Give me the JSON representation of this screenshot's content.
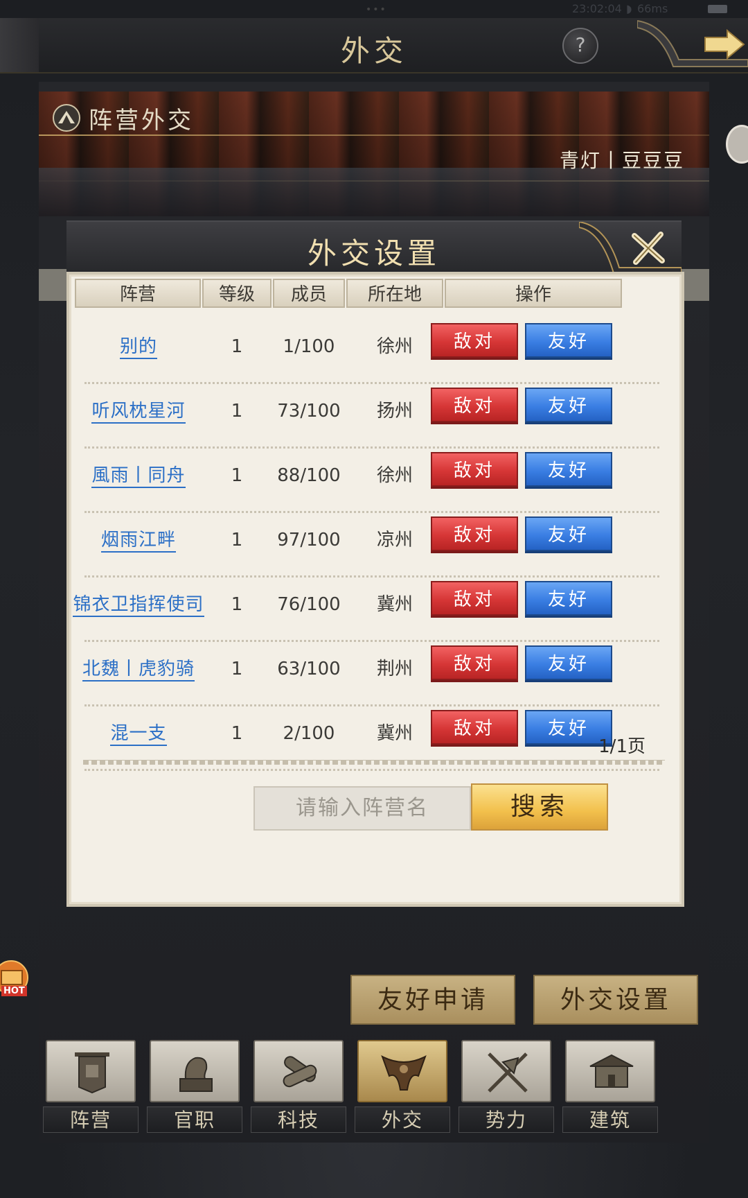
{
  "status": {
    "time": "23:02:04",
    "ping": "66ms"
  },
  "header": {
    "title": "外交",
    "help_label": "?"
  },
  "banner": {
    "title": "阵营外交",
    "camp_name": "青灯丨豆豆豆"
  },
  "modal": {
    "title": "外交设置",
    "columns": [
      "阵营",
      "等级",
      "成员",
      "所在地",
      "操作"
    ],
    "hostile_label": "敌对",
    "friendly_label": "友好",
    "rows": [
      {
        "name": "别的",
        "level": "1",
        "members": "1/100",
        "location": "徐州"
      },
      {
        "name": "听风枕星河",
        "level": "1",
        "members": "73/100",
        "location": "扬州"
      },
      {
        "name": "風雨丨同舟",
        "level": "1",
        "members": "88/100",
        "location": "徐州"
      },
      {
        "name": "烟雨江畔",
        "level": "1",
        "members": "97/100",
        "location": "凉州"
      },
      {
        "name": "锦衣卫指挥使司",
        "level": "1",
        "members": "76/100",
        "location": "冀州"
      },
      {
        "name": "北魏丨虎豹骑",
        "level": "1",
        "members": "63/100",
        "location": "荆州"
      },
      {
        "name": "混一支",
        "level": "1",
        "members": "2/100",
        "location": "冀州"
      }
    ],
    "pager": "1/1页",
    "search_placeholder": "请输入阵营名",
    "search_label": "搜索"
  },
  "actions": {
    "friend_request": "友好申请",
    "diplomacy_settings": "外交设置"
  },
  "nav": [
    {
      "label": "阵营",
      "icon": "banner-icon"
    },
    {
      "label": "官职",
      "icon": "seal-icon"
    },
    {
      "label": "科技",
      "icon": "scroll-icon"
    },
    {
      "label": "外交",
      "icon": "diplomacy-icon"
    },
    {
      "label": "势力",
      "icon": "weapons-icon"
    },
    {
      "label": "建筑",
      "icon": "palace-icon"
    }
  ],
  "hot_badge": "HOT",
  "colors": {
    "hostile": "#d63636",
    "friendly": "#3a7ee3",
    "link": "#2b6fc6",
    "gold": "#f2c04c"
  }
}
